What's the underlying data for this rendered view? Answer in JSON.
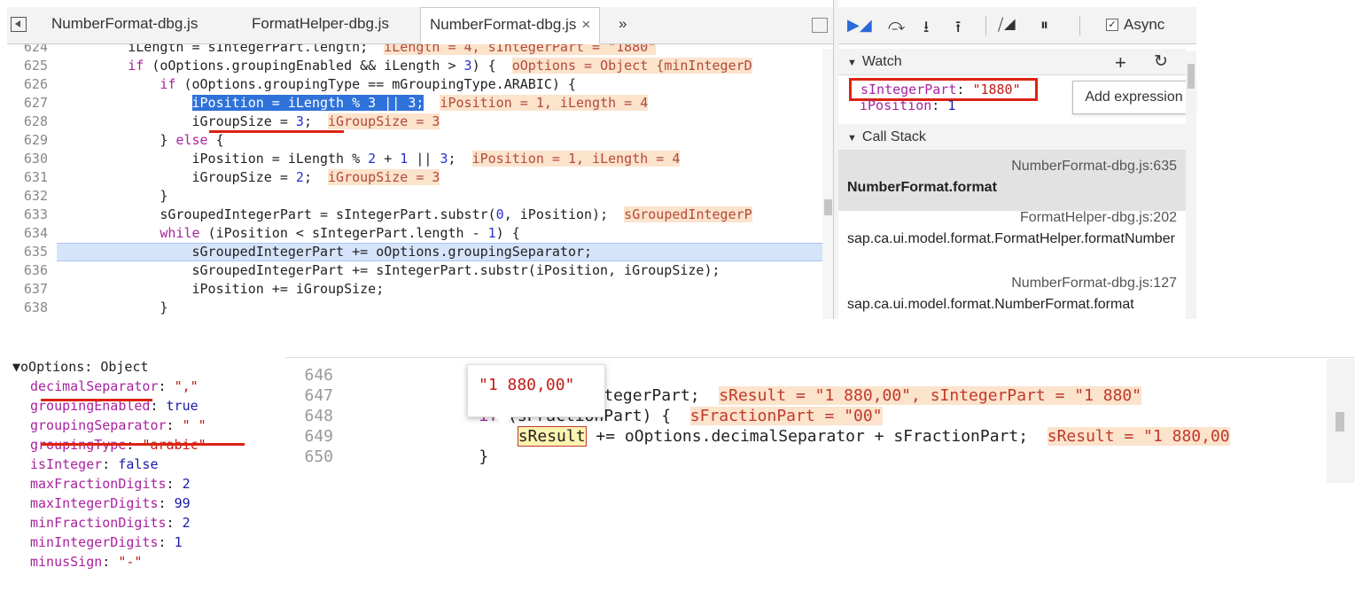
{
  "tabs": [
    {
      "label": "NumberFormat-dbg.js",
      "active": false
    },
    {
      "label": "FormatHelper-dbg.js",
      "active": false
    },
    {
      "label": "NumberFormat-dbg.js",
      "active": true,
      "close": "×"
    }
  ],
  "tab_overflow": "»",
  "code_lines": [
    {
      "ln": "624",
      "html": "<span>        iLength = sIntegerPart.length;  </span><span class=\"ann\">iLength = 4, sIntegerPart = \"1880\"</span>"
    },
    {
      "ln": "625",
      "html": "        <span class=\"kw\">if</span> (oOptions.groupingEnabled &amp;&amp; iLength &gt; <span class=\"num\">3</span>) {  <span class=\"ann\">oOptions = Object {minIntegerD</span>"
    },
    {
      "ln": "626",
      "html": "            <span class=\"kw\">if</span> (oOptions.groupingType == mGroupingType.ARABIC) {"
    },
    {
      "ln": "627",
      "html": "                <span class=\"sel\">iPosition = iLength % 3 || 3;</span>  <span class=\"ann\">iPosition = 1, iLength = 4</span>"
    },
    {
      "ln": "628",
      "html": "                iGroupSize = <span class=\"num\">3</span>;  <span class=\"ann\">iGroupSize = 3</span>"
    },
    {
      "ln": "629",
      "html": "            } <span class=\"kw\">else</span> {"
    },
    {
      "ln": "630",
      "html": "                iPosition = iLength % <span class=\"num\">2</span> + <span class=\"num\">1</span> || <span class=\"num\">3</span>;  <span class=\"ann\">iPosition = 1, iLength = 4</span>"
    },
    {
      "ln": "631",
      "html": "                iGroupSize = <span class=\"num\">2</span>;  <span class=\"ann\">iGroupSize = 3</span>"
    },
    {
      "ln": "632",
      "html": "            }"
    },
    {
      "ln": "633",
      "html": "            sGroupedIntegerPart = sIntegerPart.substr(<span class=\"num\">0</span>, iPosition);  <span class=\"ann\">sGroupedIntegerP</span>"
    },
    {
      "ln": "634",
      "html": "            <span class=\"kw\">while</span> (iPosition &lt; sIntegerPart.length - <span class=\"num\">1</span>) {"
    },
    {
      "ln": "635",
      "html": "                sGroupedIntegerPart += oOptions.groupingSeparator;"
    },
    {
      "ln": "636",
      "html": "                sGroupedIntegerPart += sIntegerPart.substr(iPosition, iGroupSize);"
    },
    {
      "ln": "637",
      "html": "                iPosition += iGroupSize;"
    },
    {
      "ln": "638",
      "html": "            }"
    }
  ],
  "toolbar": {
    "async_label": "Async",
    "async_checked": "✓"
  },
  "watch": {
    "title": "Watch",
    "add": "+",
    "refresh": "↻",
    "items": [
      {
        "name": "sIntegerPart",
        "value": "\"1880\""
      },
      {
        "name": "iPosition",
        "value": "1"
      }
    ],
    "add_expression": "Add expression"
  },
  "call_stack": {
    "title": "Call Stack",
    "frames": [
      {
        "location": "NumberFormat-dbg.js:635",
        "function": "NumberFormat.format"
      },
      {
        "location": "FormatHelper-dbg.js:202",
        "function": "sap.ca.ui.model.format.FormatHelper.formatNumber"
      },
      {
        "location": "NumberFormat-dbg.js:127",
        "function": "sap.ca.ui.model.format.NumberFormat.format"
      }
    ]
  },
  "options": {
    "header": "oOptions: Object",
    "props": [
      {
        "name": "decimalSeparator",
        "value": "\",\"",
        "kind": "str"
      },
      {
        "name": "groupingEnabled",
        "value": "true",
        "kind": "kw"
      },
      {
        "name": "groupingSeparator",
        "value": "\" \"",
        "kind": "str"
      },
      {
        "name": "groupingType",
        "value": "\"arabic\"",
        "kind": "str"
      },
      {
        "name": "isInteger",
        "value": "false",
        "kind": "kw"
      },
      {
        "name": "maxFractionDigits",
        "value": "2",
        "kind": "num"
      },
      {
        "name": "maxIntegerDigits",
        "value": "99",
        "kind": "num"
      },
      {
        "name": "minFractionDigits",
        "value": "2",
        "kind": "num"
      },
      {
        "name": "minIntegerDigits",
        "value": "1",
        "kind": "num"
      },
      {
        "name": "minusSign",
        "value": "\"-\"",
        "kind": "str"
      }
    ]
  },
  "bottom_lines": [
    {
      "ln": "646",
      "html": "    }"
    },
    {
      "ln": "647",
      "html": "    sResult = sIntegerPart;  <span class=\"bann\">sResult = \"1 880,00\", sIntegerPart = \"1 880\"</span>"
    },
    {
      "ln": "648",
      "html": "    <span class=\"kw\">if</span> (sFractionPart) {  <span class=\"bann\">sFractionPart = \"00\"</span>"
    },
    {
      "ln": "649",
      "html": "        <span id=\"srbox\">sResult</span> += oOptions.decimalSeparator + sFractionPart;  <span class=\"bann\">sResult = \"1 880,00</span>"
    },
    {
      "ln": "650",
      "html": "    }"
    }
  ],
  "tooltip": "\"1 880,00\""
}
